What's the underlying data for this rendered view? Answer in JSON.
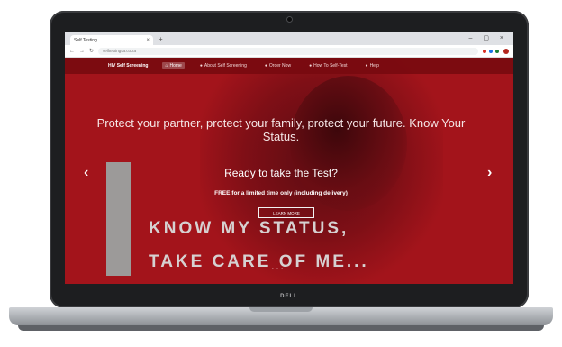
{
  "browser": {
    "tab_title": "Self Testing",
    "tab_close": "×",
    "new_tab": "+",
    "window_controls": "– ▢ ×",
    "back": "←",
    "forward": "→",
    "reload": "↻",
    "url": "selftestingsa.co.za"
  },
  "site": {
    "brand": "HIV Self Screening",
    "nav": [
      {
        "label": "Home",
        "icon": "home-icon",
        "glyph": "⌂"
      },
      {
        "label": "About Self Screening",
        "icon": "info-icon",
        "glyph": "●"
      },
      {
        "label": "Order Now",
        "icon": "cart-icon",
        "glyph": "●"
      },
      {
        "label": "How To Self-Test",
        "icon": "question-icon",
        "glyph": "●"
      },
      {
        "label": "Help",
        "icon": "help-icon",
        "glyph": "●"
      }
    ]
  },
  "hero": {
    "headline": "Protect your partner, protect your family, protect your future. Know Your Status.",
    "question": "Ready to take the Test?",
    "offer": "FREE for a limited time only (including delivery)",
    "cta": "LEARN MORE",
    "prev": "‹",
    "next": "›",
    "banner_line1": "KNOW MY STATUS,",
    "banner_line2": "TAKE CARE OF ME...",
    "carousel_dots": "• • •"
  },
  "device": {
    "logo": "DELL"
  },
  "colors": {
    "page_red": "#a3141b",
    "nav_red": "#780a0f",
    "bezel": "#1d1e20"
  }
}
